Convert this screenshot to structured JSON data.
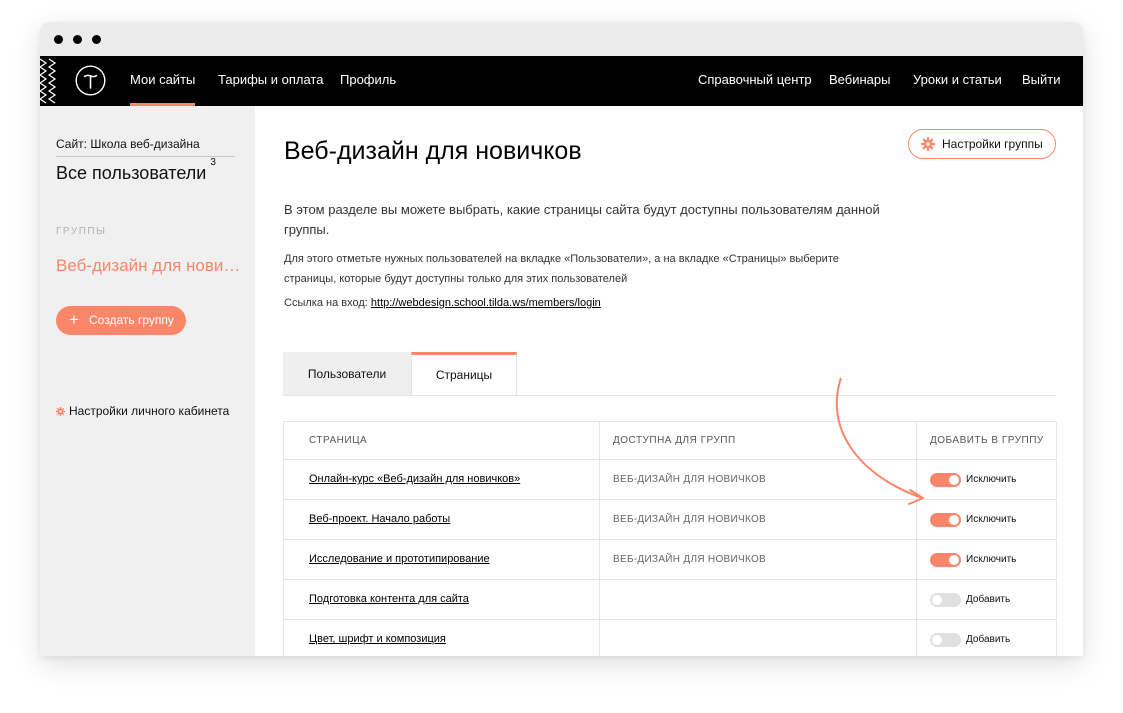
{
  "nav": {
    "left": [
      "Мои сайты",
      "Тарифы и оплата",
      "Профиль"
    ],
    "right": [
      "Справочный центр",
      "Вебинары",
      "Уроки и статьи",
      "Выйти"
    ],
    "active_index": 0
  },
  "sidebar": {
    "site_label": "Сайт: Школа веб-дизайна",
    "all_users": "Все пользователи",
    "users_count": "3",
    "groups_label": "ГРУППЫ",
    "group_name": "Веб-дизайн для новичков",
    "create_group": "Создать группу",
    "cabinet_settings": "Настройки личного кабинета"
  },
  "main": {
    "title": "Веб-дизайн для новичков",
    "group_settings": "Настройки группы",
    "description": "В этом разделе вы можете выбрать, какие страницы сайта будут доступны пользователям данной группы.",
    "hint": "Для этого отметьте нужных пользователей на вкладке «Пользователи», а на вкладке «Страницы» выберите страницы, которые будут доступны только для этих пользователей",
    "login_label": "Ссылка на вход:",
    "login_url": "http://webdesign.school.tilda.ws/members/login",
    "tabs": [
      "Пользователи",
      "Страницы"
    ],
    "active_tab": 1
  },
  "table": {
    "headers": [
      "СТРАНИЦА",
      "ДОСТУПНА ДЛЯ ГРУПП",
      "ДОБАВИТЬ В ГРУППУ"
    ],
    "rows": [
      {
        "page": "Онлайн-курс «Веб-дизайн для новичков»",
        "groups": "ВЕБ-ДИЗАЙН ДЛЯ НОВИЧКОВ",
        "enabled": true,
        "action": "Исключить"
      },
      {
        "page": "Веб-проект. Начало работы",
        "groups": "ВЕБ-ДИЗАЙН ДЛЯ НОВИЧКОВ",
        "enabled": true,
        "action": "Исключить"
      },
      {
        "page": "Исследование и прототипирование",
        "groups": "ВЕБ-ДИЗАЙН ДЛЯ НОВИЧКОВ",
        "enabled": true,
        "action": "Исключить"
      },
      {
        "page": "Подготовка контента для сайта",
        "groups": "",
        "enabled": false,
        "action": "Добавить"
      },
      {
        "page": "Цвет, шрифт и композиция",
        "groups": "",
        "enabled": false,
        "action": "Добавить"
      }
    ]
  },
  "colors": {
    "accent": "#fa8669",
    "topbar": "#000000",
    "sidebar": "#f0f0f0"
  },
  "icons": [
    "tilda-logo-icon",
    "gear-icon",
    "plus-icon",
    "annotation-arrow-icon"
  ]
}
